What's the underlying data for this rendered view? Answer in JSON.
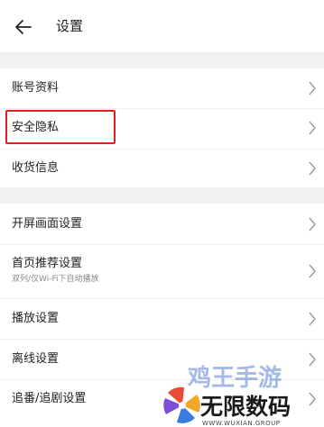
{
  "header": {
    "title": "设置",
    "back_icon": "back-arrow-icon"
  },
  "sections": [
    {
      "items": [
        {
          "label": "账号资料"
        },
        {
          "label": "安全隐私",
          "highlighted": true
        },
        {
          "label": "收货信息"
        }
      ]
    },
    {
      "items": [
        {
          "label": "开屏画面设置"
        },
        {
          "label": "首页推荐设置",
          "sublabel": "双列/仅Wi-Fi下自动播放"
        },
        {
          "label": "播放设置"
        },
        {
          "label": "离线设置"
        },
        {
          "label": "追番/追剧设置"
        }
      ]
    }
  ],
  "watermark": {
    "brand_top": "鸡王手游",
    "brand_main": "无限数码",
    "brand_url": "WWW.WUXIAN.GROUP"
  },
  "colors": {
    "highlight_border": "#e02020",
    "section_gap": "#f1f1f2"
  }
}
